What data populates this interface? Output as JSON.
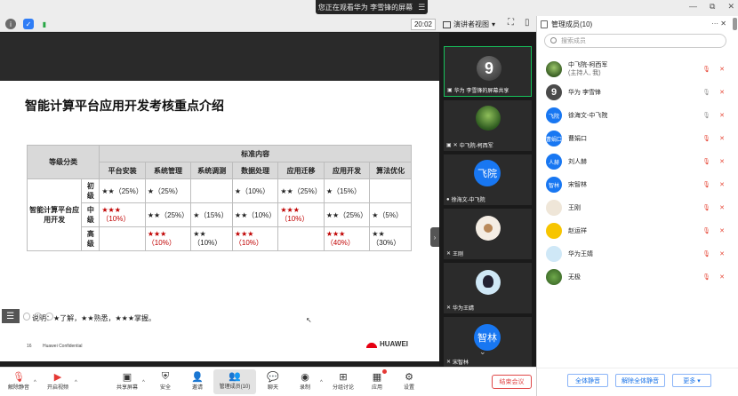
{
  "titlebar": {
    "banner": "您正在观看华为 李雪锋的屏幕",
    "banner_icon": "stop-share-icon"
  },
  "topbar": {
    "time": "20:02",
    "view_mode": "演讲者视图"
  },
  "slide": {
    "title": "智能计算平台应用开发考核重点介绍",
    "col_grade": "等级分类",
    "col_standard": "标准内容",
    "columns": [
      "平台安装",
      "系统管理",
      "系统调测",
      "数据处理",
      "应用迁移",
      "应用开发",
      "算法优化"
    ],
    "row_group": "智能计算平台应用开发",
    "rows": [
      {
        "level": "初级",
        "cells": [
          {
            "text": "★★（25%）",
            "red": false
          },
          {
            "text": "★（25%）",
            "red": false
          },
          {
            "text": "",
            "red": false
          },
          {
            "text": "★（10%）",
            "red": false
          },
          {
            "text": "★★（25%）",
            "red": false
          },
          {
            "text": "★（15%）",
            "red": false
          },
          {
            "text": "",
            "red": false
          }
        ]
      },
      {
        "level": "中级",
        "cells": [
          {
            "text": "★★★（10%）",
            "red": true
          },
          {
            "text": "★★（25%）",
            "red": false
          },
          {
            "text": "★（15%）",
            "red": false
          },
          {
            "text": "★★（10%）",
            "red": false
          },
          {
            "text": "★★★（10%）",
            "red": true
          },
          {
            "text": "★★（25%）",
            "red": false
          },
          {
            "text": "★（5%）",
            "red": false
          }
        ]
      },
      {
        "level": "高级",
        "cells": [
          {
            "text": "",
            "red": false
          },
          {
            "text": "★★★（10%）",
            "red": true
          },
          {
            "text": "★★（10%）",
            "red": false
          },
          {
            "text": "★★★（10%）",
            "red": true
          },
          {
            "text": "",
            "red": false
          },
          {
            "text": "★★★（40%）",
            "red": true
          },
          {
            "text": "★★（30%）",
            "red": false
          }
        ]
      }
    ],
    "note": "说明：★了解，★★熟悉，★★★掌握。",
    "page_num": "16",
    "confidential": "Huawei Confidential",
    "brand": "HUAWEI"
  },
  "videos": [
    {
      "name": "华为 李雪锋的屏幕共享",
      "avatar": "9",
      "icon": "screen-share-icon"
    },
    {
      "name": "中飞院-柯西军",
      "avatar": "",
      "icon": "host-icon"
    },
    {
      "name": "徐海文-中飞院",
      "avatar": "飞院",
      "icon": "mic-icon"
    },
    {
      "name": "王刚",
      "avatar": "",
      "icon": "mic-muted-icon"
    },
    {
      "name": "华为王婧",
      "avatar": "",
      "icon": "mic-muted-icon"
    },
    {
      "name": "宋智林",
      "avatar": "智林",
      "icon": "mic-muted-icon"
    }
  ],
  "panel": {
    "title": "管理成员(10)",
    "search_placeholder": "搜索成员",
    "members": [
      {
        "name": "中飞院-柯西军",
        "sub": "(主持人, 我)",
        "avatar_text": "",
        "avatar_style": "photo"
      },
      {
        "name": "华为 李雪锋",
        "sub": "",
        "avatar_text": "9",
        "avatar_style": "nine"
      },
      {
        "name": "徐海文-中飞院",
        "sub": "",
        "avatar_text": "飞院",
        "avatar_style": "blue"
      },
      {
        "name": "曹娟口",
        "sub": "",
        "avatar_text": "曹娟口",
        "avatar_style": "blue"
      },
      {
        "name": "刘人赫",
        "sub": "",
        "avatar_text": "人赫",
        "avatar_style": "blue"
      },
      {
        "name": "宋智林",
        "sub": "",
        "avatar_text": "智林",
        "avatar_style": "blue"
      },
      {
        "name": "王刚",
        "sub": "",
        "avatar_text": "",
        "avatar_style": "cat"
      },
      {
        "name": "赵运祥",
        "sub": "",
        "avatar_text": "",
        "avatar_style": "yellow"
      },
      {
        "name": "华为王婧",
        "sub": "",
        "avatar_text": "",
        "avatar_style": "cartoon"
      },
      {
        "name": "无极",
        "sub": "",
        "avatar_text": "",
        "avatar_style": "green"
      }
    ],
    "mute_all": "全体静音",
    "unmute_all": "解除全体静音",
    "more": "更多"
  },
  "toolbar": {
    "mute": "解除静音",
    "video": "开启视频",
    "share": "共享屏幕",
    "security": "安全",
    "invite": "邀请",
    "members": "管理成员(10)",
    "chat": "聊天",
    "record": "录制",
    "breakout": "分组讨论",
    "apps": "应用",
    "settings": "设置",
    "end": "结束会议"
  }
}
